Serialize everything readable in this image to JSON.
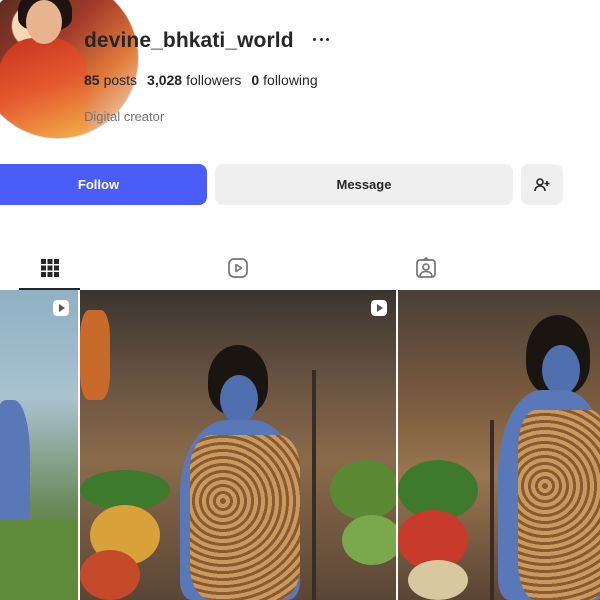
{
  "profile": {
    "username": "devine_bhkati_world",
    "posts_count": "85",
    "posts_label": "posts",
    "followers_count": "3,028",
    "followers_label": "followers",
    "following_count": "0",
    "following_label": "following",
    "bio": "Digital creator"
  },
  "actions": {
    "follow_label": "Follow",
    "message_label": "Message"
  },
  "tabs": [
    {
      "name": "posts",
      "icon": "grid-icon",
      "active": true
    },
    {
      "name": "reels",
      "icon": "reels-icon",
      "active": false
    },
    {
      "name": "tagged",
      "icon": "tagged-icon",
      "active": false
    }
  ],
  "colors": {
    "accent": "#4a5df9",
    "button_secondary": "#efefef",
    "text_primary": "#262626",
    "text_secondary": "#737373"
  }
}
